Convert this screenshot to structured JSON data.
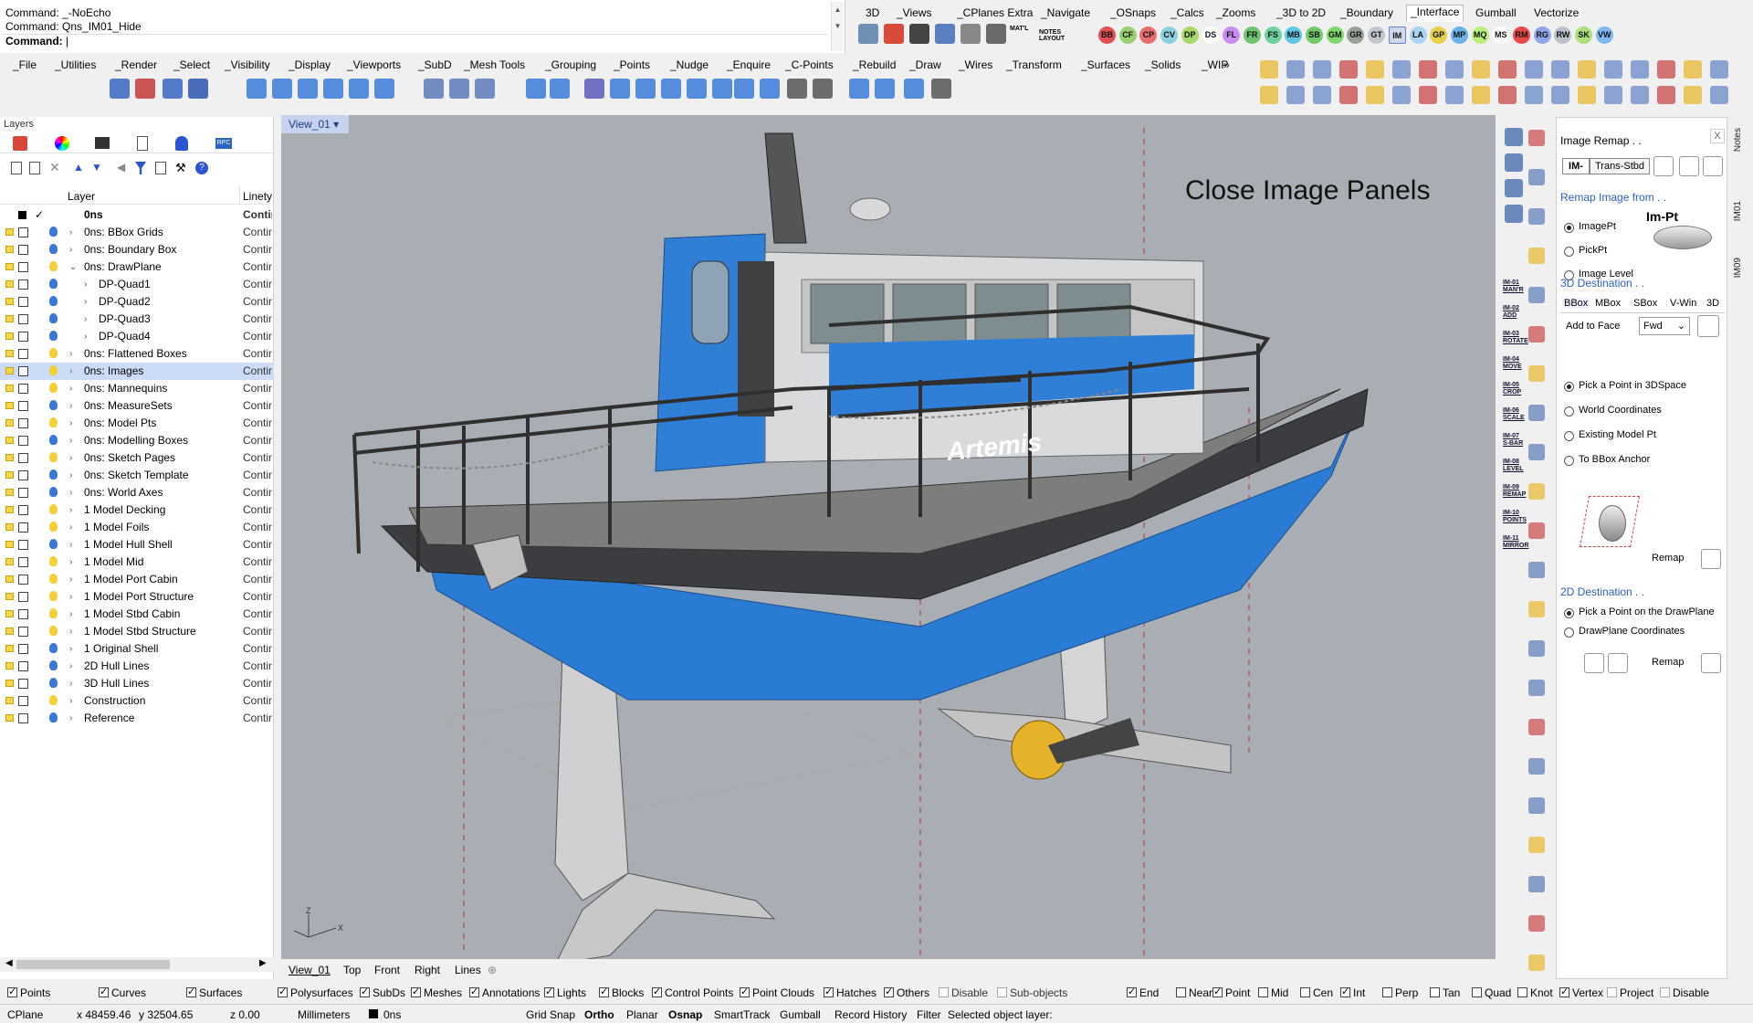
{
  "command_area": {
    "lines": [
      "Command: _-NoEcho",
      "Command: Qns_IM01_Hide"
    ],
    "prompt": "Command:"
  },
  "right_tabs": [
    "3D",
    "_Views",
    "_CPlanes Extra",
    "_Navigate",
    "_OSnaps",
    "_Calcs",
    "_Zooms",
    "_3D to 2D",
    "_Boundary",
    "_Interface",
    "Gumball",
    "Vectorize"
  ],
  "right_tab_active": "_Interface",
  "circle_buttons": [
    {
      "label": "BB",
      "color": "#e05050"
    },
    {
      "label": "CF",
      "color": "#9bd070"
    },
    {
      "label": "CP",
      "color": "#e86d6d"
    },
    {
      "label": "CV",
      "color": "#8fd0e0"
    },
    {
      "label": "DP",
      "color": "#a8d86a"
    },
    {
      "label": "DS",
      "color": "#ffffff"
    },
    {
      "label": "FL",
      "color": "#c98cf0"
    },
    {
      "label": "FR",
      "color": "#6fc46f"
    },
    {
      "label": "FS",
      "color": "#6fd0a0"
    },
    {
      "label": "MB",
      "color": "#5ec7e3"
    },
    {
      "label": "SB",
      "color": "#72c96d"
    },
    {
      "label": "GM",
      "color": "#7fd86b"
    },
    {
      "label": "GR",
      "color": "#9aa09a"
    },
    {
      "label": "GT",
      "color": "#c0c6cc"
    },
    {
      "label": "IM",
      "color": "#cfd8ea"
    },
    {
      "label": "LA",
      "color": "#a9d4f2"
    },
    {
      "label": "GP",
      "color": "#e8d14a"
    },
    {
      "label": "MP",
      "color": "#6ab3e8"
    },
    {
      "label": "MQ",
      "color": "#b8f07a"
    },
    {
      "label": "MS",
      "color": "#ffffff"
    },
    {
      "label": "RM",
      "color": "#e84848"
    },
    {
      "label": "RG",
      "color": "#8fa6e8"
    },
    {
      "label": "RW",
      "color": "#b9c1c9"
    },
    {
      "label": "SK",
      "color": "#ade07a"
    },
    {
      "label": "VW",
      "color": "#7fb8f2"
    }
  ],
  "menubar": [
    "_File",
    "_Utilities",
    "_Render",
    "_Select",
    "_Visibility",
    "_Display",
    "_Viewports",
    "_SubD",
    "_Mesh Tools",
    "_Grouping",
    "_Points",
    "_Nudge",
    "_Enquire",
    "_C-Points",
    "_Rebuild",
    "_Draw",
    "_Wires",
    "_Transform",
    "_Surfaces",
    "_Solids",
    "_WIP"
  ],
  "layers_panel": {
    "title": "Layers",
    "col_layer": "Layer",
    "col_linetype": "Linety",
    "current_layer": "0ns",
    "linetype_value": "Contin",
    "rows": [
      {
        "name": "0ns: BBox Grids",
        "level": 0,
        "bulb": "#3a78d8"
      },
      {
        "name": "0ns: Boundary Box",
        "level": 0,
        "bulb": "#3a78d8"
      },
      {
        "name": "0ns: DrawPlane",
        "level": 0,
        "bulb": "#f3cf3a",
        "expanded": true
      },
      {
        "name": "DP-Quad1",
        "level": 1,
        "bulb": "#3a78d8"
      },
      {
        "name": "DP-Quad2",
        "level": 1,
        "bulb": "#3a78d8"
      },
      {
        "name": "DP-Quad3",
        "level": 1,
        "bulb": "#3a78d8"
      },
      {
        "name": "DP-Quad4",
        "level": 1,
        "bulb": "#3a78d8"
      },
      {
        "name": "0ns: Flattened Boxes",
        "level": 0,
        "bulb": "#f3cf3a"
      },
      {
        "name": "0ns: Images",
        "level": 0,
        "bulb": "#f3cf3a",
        "selected": true
      },
      {
        "name": "0ns: Mannequins",
        "level": 0,
        "bulb": "#f3cf3a"
      },
      {
        "name": "0ns: MeasureSets",
        "level": 0,
        "bulb": "#3a78d8"
      },
      {
        "name": "0ns: Model Pts",
        "level": 0,
        "bulb": "#f3cf3a"
      },
      {
        "name": "0ns: Modelling Boxes",
        "level": 0,
        "bulb": "#3a78d8"
      },
      {
        "name": "0ns: Sketch Pages",
        "level": 0,
        "bulb": "#f3cf3a"
      },
      {
        "name": "0ns: Sketch Template",
        "level": 0,
        "bulb": "#3a78d8"
      },
      {
        "name": "0ns: World Axes",
        "level": 0,
        "bulb": "#3a78d8"
      },
      {
        "name": "1 Model Decking",
        "level": 0,
        "bulb": "#f3cf3a"
      },
      {
        "name": "1 Model Foils",
        "level": 0,
        "bulb": "#f3cf3a"
      },
      {
        "name": "1 Model Hull Shell",
        "level": 0,
        "bulb": "#3a78d8"
      },
      {
        "name": "1 Model Mid",
        "level": 0,
        "bulb": "#f3cf3a"
      },
      {
        "name": "1 Model Port Cabin",
        "level": 0,
        "bulb": "#f3cf3a"
      },
      {
        "name": "1 Model Port Structure",
        "level": 0,
        "bulb": "#f3cf3a"
      },
      {
        "name": "1 Model Stbd Cabin",
        "level": 0,
        "bulb": "#f3cf3a"
      },
      {
        "name": "1 Model Stbd Structure",
        "level": 0,
        "bulb": "#f3cf3a"
      },
      {
        "name": "1 Original Shell",
        "level": 0,
        "bulb": "#3a78d8"
      },
      {
        "name": "2D Hull Lines",
        "level": 0,
        "bulb": "#3a78d8"
      },
      {
        "name": "3D Hull Lines",
        "level": 0,
        "bulb": "#3a78d8"
      },
      {
        "name": "Construction",
        "level": 0,
        "bulb": "#f3cf3a"
      },
      {
        "name": "Reference",
        "level": 0,
        "bulb": "#3a78d8"
      }
    ]
  },
  "viewport": {
    "tab": "View_01",
    "overlay_title": "Close Image Panels",
    "boat_name": "Artemis",
    "axis_z": "Z",
    "axis_x": "X"
  },
  "viewport_tabs": [
    "View_01",
    "Top",
    "Front",
    "Right",
    "Lines"
  ],
  "filters": [
    {
      "label": "Points",
      "checked": true
    },
    {
      "label": "Curves",
      "checked": true
    },
    {
      "label": "Surfaces",
      "checked": true
    },
    {
      "label": "Polysurfaces",
      "checked": true
    },
    {
      "label": "SubDs",
      "checked": true
    },
    {
      "label": "Meshes",
      "checked": true
    },
    {
      "label": "Annotations",
      "checked": true
    },
    {
      "label": "Lights",
      "checked": true
    },
    {
      "label": "Blocks",
      "checked": true
    },
    {
      "label": "Control Points",
      "checked": true
    },
    {
      "label": "Point Clouds",
      "checked": true
    },
    {
      "label": "Hatches",
      "checked": true
    },
    {
      "label": "Others",
      "checked": true
    },
    {
      "label": "Disable",
      "checked": false,
      "disabled": true
    },
    {
      "label": "Sub-objects",
      "checked": false,
      "disabled": true
    }
  ],
  "osnaps": [
    {
      "label": "End",
      "checked": true
    },
    {
      "label": "Near",
      "checked": false
    },
    {
      "label": "Point",
      "checked": true
    },
    {
      "label": "Mid",
      "checked": false
    },
    {
      "label": "Cen",
      "checked": false
    },
    {
      "label": "Int",
      "checked": true
    },
    {
      "label": "Perp",
      "checked": false
    },
    {
      "label": "Tan",
      "checked": false
    },
    {
      "label": "Quad",
      "checked": false
    },
    {
      "label": "Knot",
      "checked": false
    },
    {
      "label": "Vertex",
      "checked": true
    },
    {
      "label": "Project",
      "checked": false,
      "disabled": true
    },
    {
      "label": "Disable",
      "checked": false,
      "disabled": true
    }
  ],
  "statusbar": {
    "cplane": "CPlane",
    "x": "x 48459.46",
    "y": "y 32504.65",
    "z": "z 0.00",
    "units": "Millimeters",
    "layer": "0ns",
    "toggles": [
      "Grid Snap",
      "Ortho",
      "Planar",
      "Osnap",
      "SmartTrack",
      "Gumball",
      "Record History",
      "Filter"
    ],
    "bold_toggles": [
      "Ortho",
      "Osnap"
    ],
    "message": "Selected object layer:"
  },
  "im_strip": [
    "IM-01 MAN'R",
    "IM-02 ADD",
    "IM-03 ROTATE",
    "IM-04 MOVE",
    "IM-05 CROP",
    "IM-06 SCALE",
    "IM-07 S-BAR",
    "IM-08 LEVEL",
    "IM-09 REMAP",
    "IM-10 POINTS",
    "IM-11 MIRROR"
  ],
  "image_remap_panel": {
    "title": "Image Remap . .",
    "tab_im": "IM-",
    "tab_trans": "Trans-Stbd",
    "remap_from_heading": "Remap Image from . .",
    "im_pt_label": "Im-Pt",
    "from_options": [
      {
        "label": "ImagePt",
        "selected": true
      },
      {
        "label": "PickPt",
        "selected": false
      },
      {
        "label": "Image Level",
        "selected": false
      }
    ],
    "dest3d_heading": "3D Destination . .",
    "dest_tabs": [
      "BBox",
      "MBox",
      "SBox",
      "V-Win",
      "3D"
    ],
    "add_to_face_label": "Add to Face",
    "add_to_face_value": "Fwd",
    "dest3d_options": [
      {
        "label": "Pick a Point in 3DSpace",
        "selected": true
      },
      {
        "label": "World Coordinates",
        "selected": false
      },
      {
        "label": "Existing Model Pt",
        "selected": false
      },
      {
        "label": "To BBox Anchor",
        "selected": false
      }
    ],
    "remap_label": "Remap",
    "dest2d_heading": "2D Destination . .",
    "dest2d_options": [
      {
        "label": "Pick a Point on the DrawPlane",
        "selected": true
      },
      {
        "label": "DrawPlane Coordinates",
        "selected": false
      }
    ]
  },
  "vertical_tabs": [
    "Notes",
    "IM01",
    "IM09"
  ]
}
